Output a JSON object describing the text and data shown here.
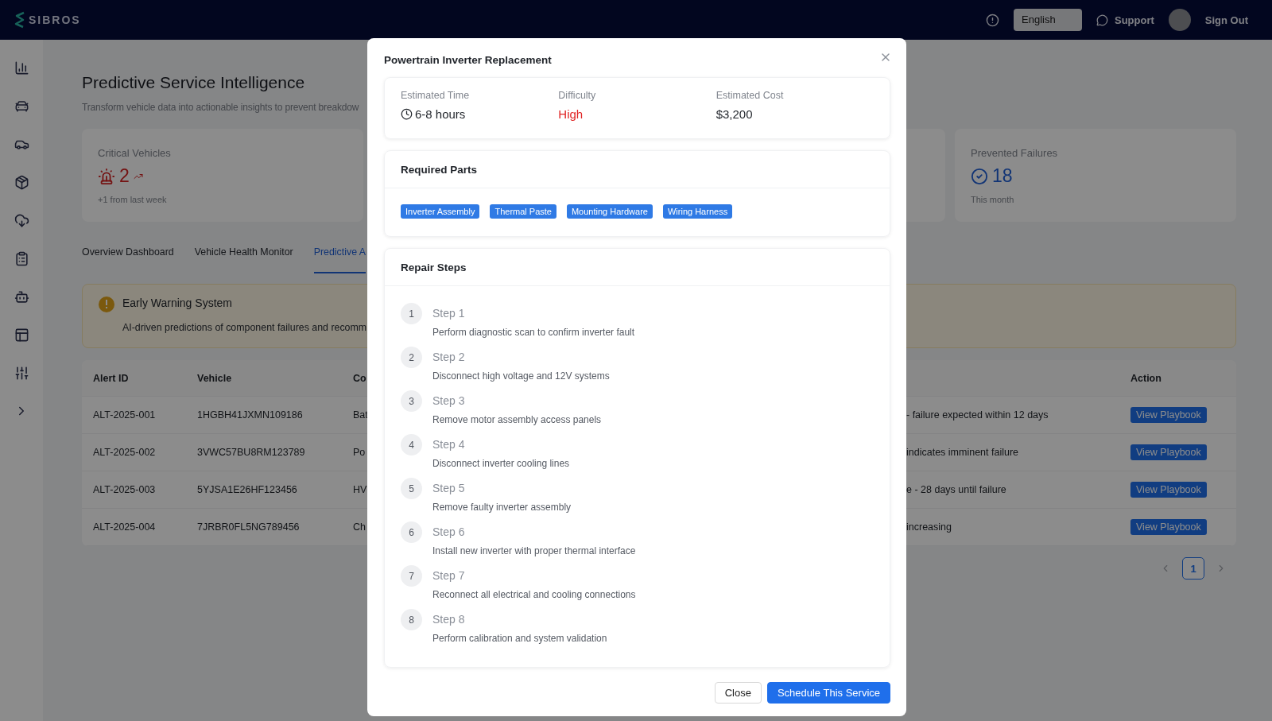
{
  "header": {
    "brand": "SIBROS",
    "language": "English",
    "support": "Support",
    "sign_out": "Sign Out"
  },
  "sidebar": {
    "items": [
      {
        "kind": "chart"
      },
      {
        "kind": "cars"
      },
      {
        "kind": "car"
      },
      {
        "kind": "box"
      },
      {
        "kind": "cloud"
      },
      {
        "kind": "list"
      },
      {
        "kind": "bot"
      },
      {
        "kind": "layout"
      },
      {
        "kind": "sliders"
      },
      {
        "kind": "expand"
      }
    ]
  },
  "page": {
    "title": "Predictive Service Intelligence",
    "subtitle": "Transform vehicle data into actionable insights to prevent breakdow"
  },
  "stat_cards": [
    {
      "kind": "alert",
      "label": "Critical Vehicles",
      "value": "2",
      "note": "+1 from last week"
    },
    {
      "kind": "covered"
    },
    {
      "kind": "success",
      "label": "Prevented Failures",
      "value": "18",
      "note": "This month"
    }
  ],
  "tabs": [
    {
      "label": "Overview Dashboard",
      "selected": false
    },
    {
      "label": "Vehicle Health Monitor",
      "selected": false
    },
    {
      "label": "Predictive A",
      "selected": true
    }
  ],
  "banner": {
    "title": "Early Warning System",
    "text": "AI-driven predictions of component failures and recomm"
  },
  "table": {
    "columns": [
      "Alert ID",
      "Vehicle",
      "Co",
      "Action"
    ],
    "rows": [
      {
        "cells": [
          "ALT-2025-001",
          "1HGBH41JXMN109186",
          "Bat",
          "- failure expected within 12 days"
        ],
        "action": "View Playbook"
      },
      {
        "cells": [
          "ALT-2025-002",
          "3VWC57BU8RM123789",
          "Po",
          "indicates imminent failure"
        ],
        "action": "View Playbook"
      },
      {
        "cells": [
          "ALT-2025-003",
          "5YJSA1E26HF123456",
          "HV",
          "e - 28 days until failure"
        ],
        "action": "View Playbook"
      },
      {
        "cells": [
          "ALT-2025-004",
          "7JRBR0FL5NG789456",
          "Ch",
          "increasing"
        ],
        "action": "View Playbook"
      }
    ]
  },
  "pagination": {
    "pages": [
      {
        "label": "1",
        "selected": true
      }
    ]
  },
  "modal": {
    "title": "Powertrain Inverter Replacement",
    "info": [
      {
        "kind": "time",
        "label": "Estimated Time",
        "value": "6-8 hours"
      },
      {
        "kind": "danger",
        "label": "Difficulty",
        "value": "High"
      },
      {
        "kind": "plain",
        "label": "Estimated Cost",
        "value": "$3,200"
      }
    ],
    "parts_title": "Required Parts",
    "parts": [
      "Inverter Assembly",
      "Thermal Paste",
      "Mounting Hardware",
      "Wiring Harness"
    ],
    "steps_title": "Repair Steps",
    "steps": [
      {
        "number": "1",
        "title": "Step 1",
        "text": "Perform diagnostic scan to confirm inverter fault"
      },
      {
        "number": "2",
        "title": "Step 2",
        "text": "Disconnect high voltage and 12V systems"
      },
      {
        "number": "3",
        "title": "Step 3",
        "text": "Remove motor assembly access panels"
      },
      {
        "number": "4",
        "title": "Step 4",
        "text": "Disconnect inverter cooling lines"
      },
      {
        "number": "5",
        "title": "Step 5",
        "text": "Remove faulty inverter assembly"
      },
      {
        "number": "6",
        "title": "Step 6",
        "text": "Install new inverter with proper thermal interface"
      },
      {
        "number": "7",
        "title": "Step 7",
        "text": "Reconnect all electrical and cooling connections"
      },
      {
        "number": "8",
        "title": "Step 8",
        "text": "Perform calibration and system validation"
      }
    ],
    "buttons": [
      {
        "kind": "secondary",
        "label": "Close"
      },
      {
        "kind": "primary",
        "label": "Schedule This Service"
      }
    ]
  }
}
